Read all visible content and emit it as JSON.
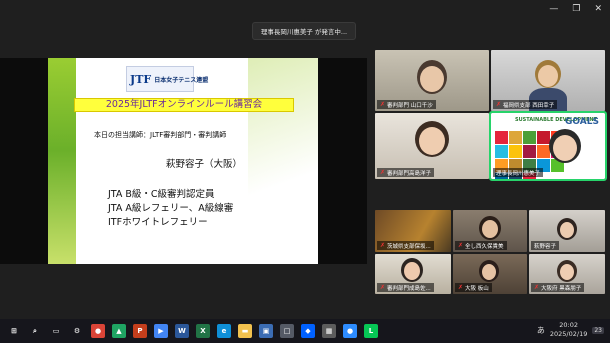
{
  "window": {
    "minimize_icon": "—",
    "maximize_icon": "❐",
    "close_icon": "✕"
  },
  "speaking_banner": "理事長岡川惠美子 が発言中...",
  "slide": {
    "logo_mark": "JTF",
    "logo_text": "日本女子テニス連盟",
    "title": "2025年JLTFオンラインルール講習会",
    "lecturer_line": "本日の担当講師：JLTF審判部門・審判講師",
    "lecturer_name": "萩野容子（大阪）",
    "credentials": [
      "JTA B級・C級審判認定員",
      "JTA A級レフェリー、A級線審",
      "ITFホワイトレフェリー"
    ]
  },
  "participants": [
    {
      "label": "審判部門 山口千沙",
      "muted": true
    },
    {
      "label": "福岡県支部 西田幸子",
      "muted": true
    },
    {
      "label": "審判部門高島洋子",
      "muted": true
    },
    {
      "label": "理事長岡川惠美子",
      "muted": false
    },
    {
      "label": "茨城県支部保坂...",
      "muted": true
    },
    {
      "label": "全し西久保貴美",
      "muted": true
    },
    {
      "label": "萩野容子",
      "muted": false
    },
    {
      "label": "審判部門成島佐...",
      "muted": true
    },
    {
      "label": "大阪 板山",
      "muted": true
    },
    {
      "label": "大阪府 黒森朋子",
      "muted": true
    }
  ],
  "sdg": {
    "title": "SUSTAINABLE DEVELOPMENT",
    "word": "GOALS",
    "colors": [
      "#e5243b",
      "#dda63a",
      "#4c9f38",
      "#c5192d",
      "#ff3a21",
      "#26bde2",
      "#fcc30b",
      "#a21942",
      "#fd6925",
      "#dd1367",
      "#fd9d24",
      "#bf8b2e",
      "#3f7e44",
      "#0a97d9",
      "#56c02b",
      "#00689d",
      "#19486a",
      "#e5243b"
    ]
  },
  "taskbar": {
    "icons": [
      {
        "name": "windows-start-icon",
        "glyph": "⊞",
        "color": "#16161c"
      },
      {
        "name": "search-icon",
        "glyph": "⌕",
        "color": "#16161c"
      },
      {
        "name": "task-view-icon",
        "glyph": "▭",
        "color": "#16161c"
      },
      {
        "name": "settings-icon",
        "glyph": "⚙",
        "color": "#16161c"
      },
      {
        "name": "chrome-icon",
        "glyph": "●",
        "color": "#db4437"
      },
      {
        "name": "drive-icon",
        "glyph": "▲",
        "color": "#1fa463"
      },
      {
        "name": "powerpoint-icon",
        "glyph": "P",
        "color": "#c43e1c"
      },
      {
        "name": "media-icon",
        "glyph": "▶",
        "color": "#4285f4"
      },
      {
        "name": "word-icon",
        "glyph": "W",
        "color": "#2b579a"
      },
      {
        "name": "excel-icon",
        "glyph": "X",
        "color": "#217346"
      },
      {
        "name": "edge-icon",
        "glyph": "e",
        "color": "#0f8fd8"
      },
      {
        "name": "folder-icon",
        "glyph": "▬",
        "color": "#f2c14e"
      },
      {
        "name": "photos-icon",
        "glyph": "▣",
        "color": "#3b6cb4"
      },
      {
        "name": "app-icon",
        "glyph": "□",
        "color": "#555a66"
      },
      {
        "name": "dropbox-icon",
        "glyph": "◆",
        "color": "#0061ff"
      },
      {
        "name": "grid-app-icon",
        "glyph": "▦",
        "color": "#5c5c5c"
      },
      {
        "name": "zoom-icon",
        "glyph": "●",
        "color": "#2d8cff"
      },
      {
        "name": "line-icon",
        "glyph": "L",
        "color": "#06c755"
      }
    ],
    "ime": "あ",
    "time": "20:02",
    "date": "2025/02/19",
    "notification_count": "23"
  }
}
